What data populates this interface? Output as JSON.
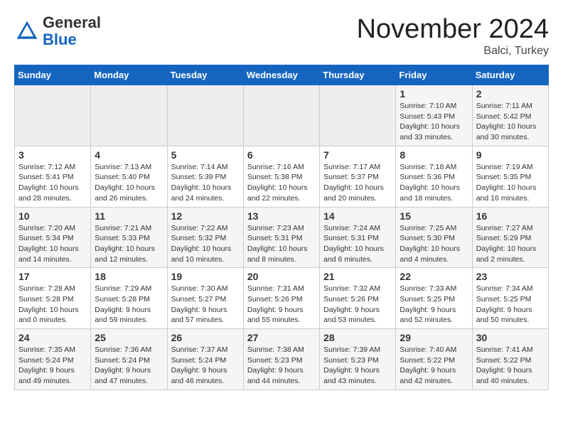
{
  "header": {
    "logo_general": "General",
    "logo_blue": "Blue",
    "month_title": "November 2024",
    "location": "Balci, Turkey"
  },
  "weekdays": [
    "Sunday",
    "Monday",
    "Tuesday",
    "Wednesday",
    "Thursday",
    "Friday",
    "Saturday"
  ],
  "weeks": [
    [
      {
        "day": "",
        "info": ""
      },
      {
        "day": "",
        "info": ""
      },
      {
        "day": "",
        "info": ""
      },
      {
        "day": "",
        "info": ""
      },
      {
        "day": "",
        "info": ""
      },
      {
        "day": "1",
        "info": "Sunrise: 7:10 AM\nSunset: 5:43 PM\nDaylight: 10 hours\nand 33 minutes."
      },
      {
        "day": "2",
        "info": "Sunrise: 7:11 AM\nSunset: 5:42 PM\nDaylight: 10 hours\nand 30 minutes."
      }
    ],
    [
      {
        "day": "3",
        "info": "Sunrise: 7:12 AM\nSunset: 5:41 PM\nDaylight: 10 hours\nand 28 minutes."
      },
      {
        "day": "4",
        "info": "Sunrise: 7:13 AM\nSunset: 5:40 PM\nDaylight: 10 hours\nand 26 minutes."
      },
      {
        "day": "5",
        "info": "Sunrise: 7:14 AM\nSunset: 5:39 PM\nDaylight: 10 hours\nand 24 minutes."
      },
      {
        "day": "6",
        "info": "Sunrise: 7:16 AM\nSunset: 5:38 PM\nDaylight: 10 hours\nand 22 minutes."
      },
      {
        "day": "7",
        "info": "Sunrise: 7:17 AM\nSunset: 5:37 PM\nDaylight: 10 hours\nand 20 minutes."
      },
      {
        "day": "8",
        "info": "Sunrise: 7:18 AM\nSunset: 5:36 PM\nDaylight: 10 hours\nand 18 minutes."
      },
      {
        "day": "9",
        "info": "Sunrise: 7:19 AM\nSunset: 5:35 PM\nDaylight: 10 hours\nand 16 minutes."
      }
    ],
    [
      {
        "day": "10",
        "info": "Sunrise: 7:20 AM\nSunset: 5:34 PM\nDaylight: 10 hours\nand 14 minutes."
      },
      {
        "day": "11",
        "info": "Sunrise: 7:21 AM\nSunset: 5:33 PM\nDaylight: 10 hours\nand 12 minutes."
      },
      {
        "day": "12",
        "info": "Sunrise: 7:22 AM\nSunset: 5:32 PM\nDaylight: 10 hours\nand 10 minutes."
      },
      {
        "day": "13",
        "info": "Sunrise: 7:23 AM\nSunset: 5:31 PM\nDaylight: 10 hours\nand 8 minutes."
      },
      {
        "day": "14",
        "info": "Sunrise: 7:24 AM\nSunset: 5:31 PM\nDaylight: 10 hours\nand 6 minutes."
      },
      {
        "day": "15",
        "info": "Sunrise: 7:25 AM\nSunset: 5:30 PM\nDaylight: 10 hours\nand 4 minutes."
      },
      {
        "day": "16",
        "info": "Sunrise: 7:27 AM\nSunset: 5:29 PM\nDaylight: 10 hours\nand 2 minutes."
      }
    ],
    [
      {
        "day": "17",
        "info": "Sunrise: 7:28 AM\nSunset: 5:28 PM\nDaylight: 10 hours\nand 0 minutes."
      },
      {
        "day": "18",
        "info": "Sunrise: 7:29 AM\nSunset: 5:28 PM\nDaylight: 9 hours\nand 59 minutes."
      },
      {
        "day": "19",
        "info": "Sunrise: 7:30 AM\nSunset: 5:27 PM\nDaylight: 9 hours\nand 57 minutes."
      },
      {
        "day": "20",
        "info": "Sunrise: 7:31 AM\nSunset: 5:26 PM\nDaylight: 9 hours\nand 55 minutes."
      },
      {
        "day": "21",
        "info": "Sunrise: 7:32 AM\nSunset: 5:26 PM\nDaylight: 9 hours\nand 53 minutes."
      },
      {
        "day": "22",
        "info": "Sunrise: 7:33 AM\nSunset: 5:25 PM\nDaylight: 9 hours\nand 52 minutes."
      },
      {
        "day": "23",
        "info": "Sunrise: 7:34 AM\nSunset: 5:25 PM\nDaylight: 9 hours\nand 50 minutes."
      }
    ],
    [
      {
        "day": "24",
        "info": "Sunrise: 7:35 AM\nSunset: 5:24 PM\nDaylight: 9 hours\nand 49 minutes."
      },
      {
        "day": "25",
        "info": "Sunrise: 7:36 AM\nSunset: 5:24 PM\nDaylight: 9 hours\nand 47 minutes."
      },
      {
        "day": "26",
        "info": "Sunrise: 7:37 AM\nSunset: 5:24 PM\nDaylight: 9 hours\nand 46 minutes."
      },
      {
        "day": "27",
        "info": "Sunrise: 7:38 AM\nSunset: 5:23 PM\nDaylight: 9 hours\nand 44 minutes."
      },
      {
        "day": "28",
        "info": "Sunrise: 7:39 AM\nSunset: 5:23 PM\nDaylight: 9 hours\nand 43 minutes."
      },
      {
        "day": "29",
        "info": "Sunrise: 7:40 AM\nSunset: 5:22 PM\nDaylight: 9 hours\nand 42 minutes."
      },
      {
        "day": "30",
        "info": "Sunrise: 7:41 AM\nSunset: 5:22 PM\nDaylight: 9 hours\nand 40 minutes."
      }
    ]
  ]
}
